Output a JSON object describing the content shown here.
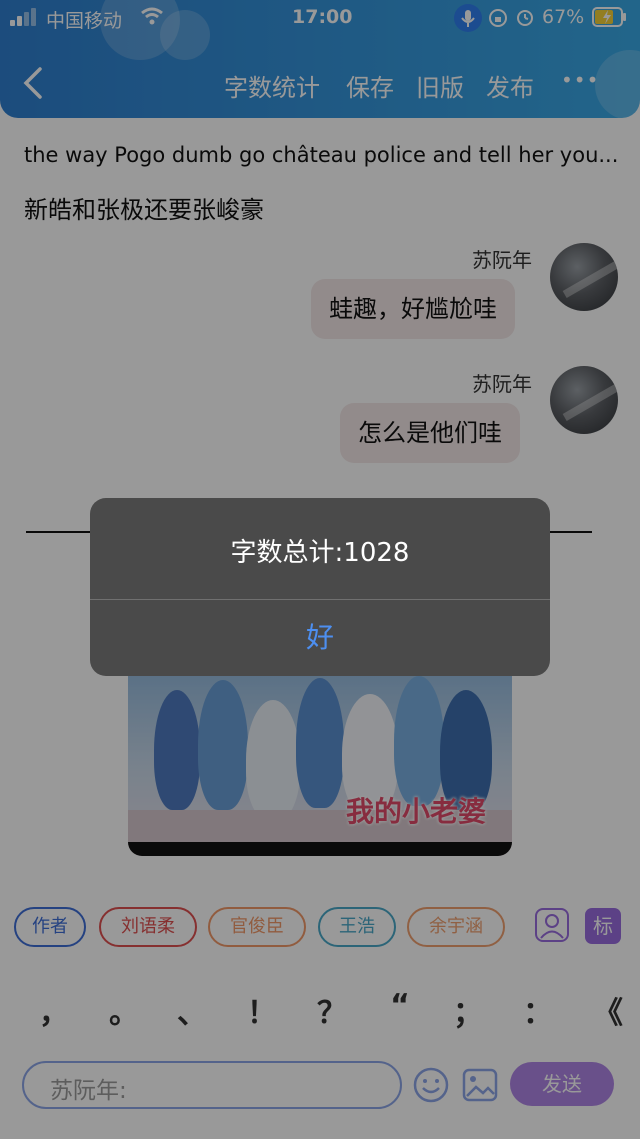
{
  "status_bar": {
    "carrier": "中国移动",
    "time": "17:00",
    "battery": "67%"
  },
  "header": {
    "actions": [
      "字数统计",
      "保存",
      "旧版",
      "发布"
    ],
    "more": "•••"
  },
  "content": {
    "line1": "the way Pogo dumb go château police and tell her you...",
    "line2": "新皓和张极还要张峻豪",
    "messages": [
      {
        "author": "苏阮年",
        "text": "蛙趣，好尴尬哇"
      },
      {
        "author": "苏阮年",
        "text": "怎么是他们哇"
      }
    ],
    "photo_caption": "我的小老婆"
  },
  "bottom": {
    "chips": [
      {
        "label": "作者",
        "color": "#3f6fd8"
      },
      {
        "label": "刘语柔",
        "color": "#e05050"
      },
      {
        "label": "官俊臣",
        "color": "#f29a6a"
      },
      {
        "label": "王浩",
        "color": "#4aa8c8"
      },
      {
        "label": "余宇涵",
        "color": "#f0a070"
      }
    ],
    "tag_label": "标",
    "punctuation": [
      "，",
      "。",
      "、",
      "！",
      "？",
      "“",
      "；",
      "：",
      "《"
    ],
    "input_placeholder": "苏阮年:",
    "send_label": "发送"
  },
  "dialog": {
    "message": "字数总计:1028",
    "ok_label": "好"
  }
}
